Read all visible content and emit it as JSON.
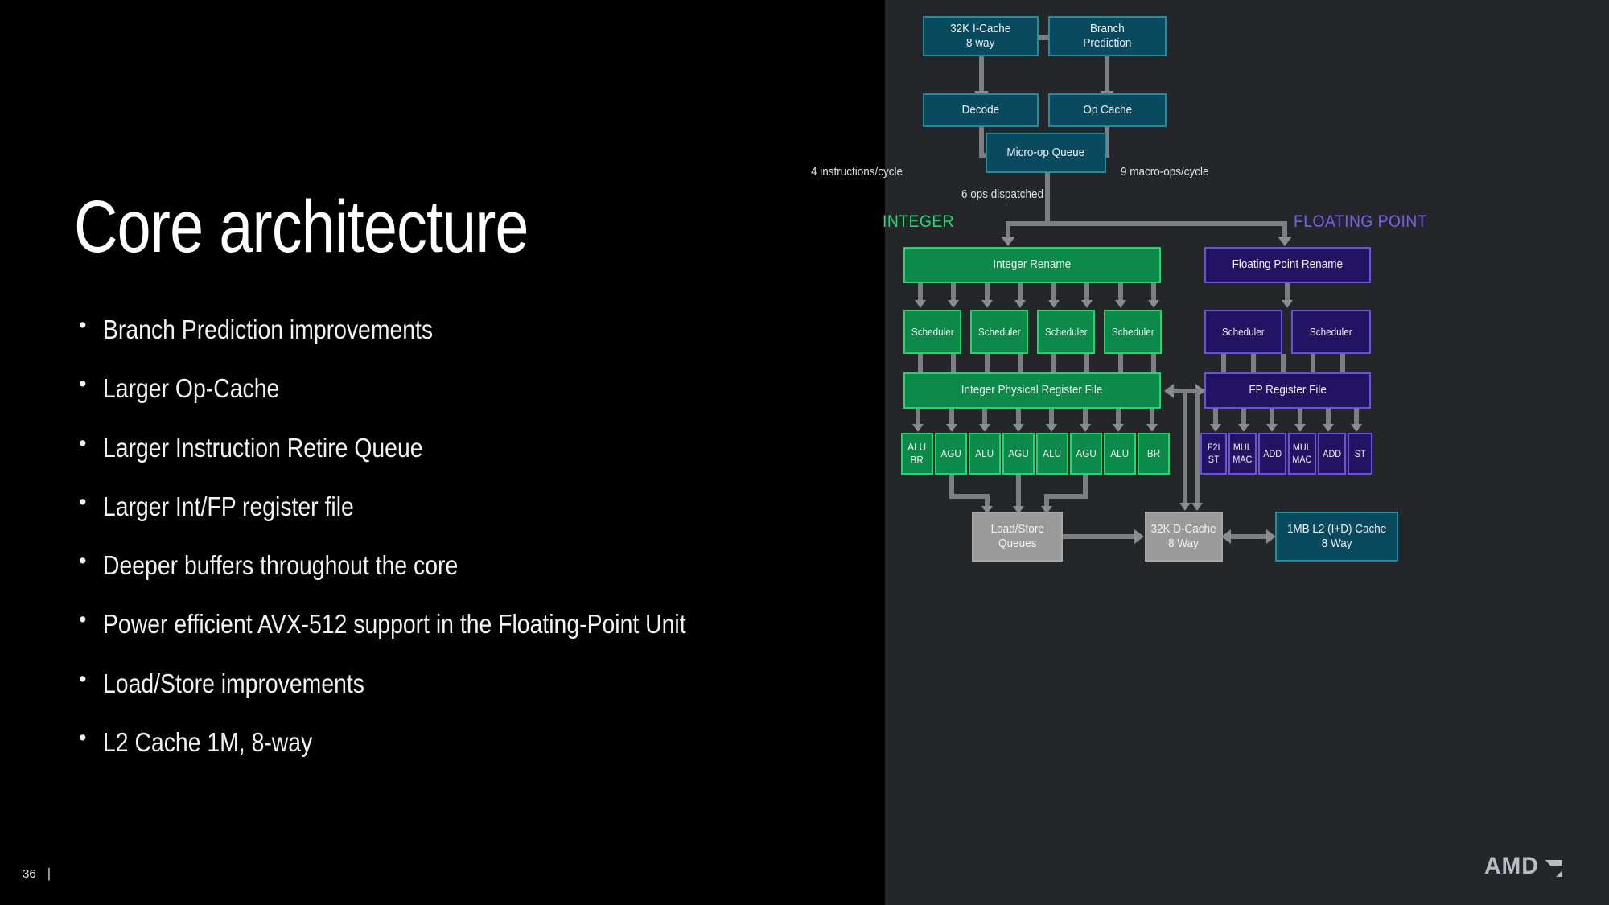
{
  "slide": {
    "title": "Core architecture",
    "page_number": "36",
    "separator": "|",
    "logo_wordmark": "AMD",
    "logo_mark": "amd-arrow-mark",
    "background_left": "#000000",
    "background_right": "#25262a"
  },
  "bullets": [
    "Branch Prediction improvements",
    "Larger Op-Cache",
    "Larger Instruction Retire Queue",
    "Larger Int/FP register file",
    "Deeper buffers throughout the core",
    "Power efficient AVX-512 support in the Floating-Point Unit",
    "Load/Store improvements",
    "L2 Cache 1M, 8-way"
  ],
  "diagram": {
    "colors": {
      "teal_fill": "#0a4a5e",
      "teal_border": "#1d8f9e",
      "green_fill": "#0b8a49",
      "green_border": "#20d96d",
      "purple_fill": "#231463",
      "purple_border": "#6a4fe8",
      "gray_fill": "#9a9a9a",
      "connector": "#7c7e83",
      "integer_label": "#21d96d",
      "float_label": "#7b5cf0"
    },
    "frontend": {
      "icache": "32K I-Cache\n8 way",
      "icache_line1": "32K I-Cache",
      "icache_line2": "8 way",
      "branch_prediction_line1": "Branch",
      "branch_prediction_line2": "Prediction",
      "decode": "Decode",
      "op_cache": "Op Cache",
      "micro_op_queue": "Micro-op Queue"
    },
    "annotations": {
      "instructions_per_cycle": "4 instructions/cycle",
      "macro_ops_per_cycle": "9 macro-ops/cycle",
      "ops_dispatched": "6 ops dispatched"
    },
    "sections": {
      "integer": "INTEGER",
      "floating_point": "FLOATING POINT"
    },
    "integer": {
      "rename": "Integer Rename",
      "schedulers": [
        "Scheduler",
        "Scheduler",
        "Scheduler",
        "Scheduler"
      ],
      "register_file": "Integer Physical Register File",
      "execution_units": [
        {
          "line1": "ALU",
          "line2": "BR"
        },
        {
          "line1": "AGU",
          "line2": ""
        },
        {
          "line1": "ALU",
          "line2": ""
        },
        {
          "line1": "AGU",
          "line2": ""
        },
        {
          "line1": "ALU",
          "line2": ""
        },
        {
          "line1": "AGU",
          "line2": ""
        },
        {
          "line1": "ALU",
          "line2": ""
        },
        {
          "line1": "BR",
          "line2": ""
        }
      ]
    },
    "floating_point": {
      "rename": "Floating Point Rename",
      "schedulers": [
        "Scheduler",
        "Scheduler"
      ],
      "register_file": "FP Register File",
      "execution_units": [
        {
          "line1": "F2I",
          "line2": "ST"
        },
        {
          "line1": "MUL",
          "line2": "MAC"
        },
        {
          "line1": "ADD",
          "line2": ""
        },
        {
          "line1": "MUL",
          "line2": "MAC"
        },
        {
          "line1": "ADD",
          "line2": ""
        },
        {
          "line1": "ST",
          "line2": ""
        }
      ]
    },
    "memory": {
      "load_store_line1": "Load/Store",
      "load_store_line2": "Queues",
      "dcache_line1": "32K D-Cache",
      "dcache_line2": "8 Way",
      "l2_line1": "1MB L2 (I+D) Cache",
      "l2_line2": "8 Way"
    }
  }
}
